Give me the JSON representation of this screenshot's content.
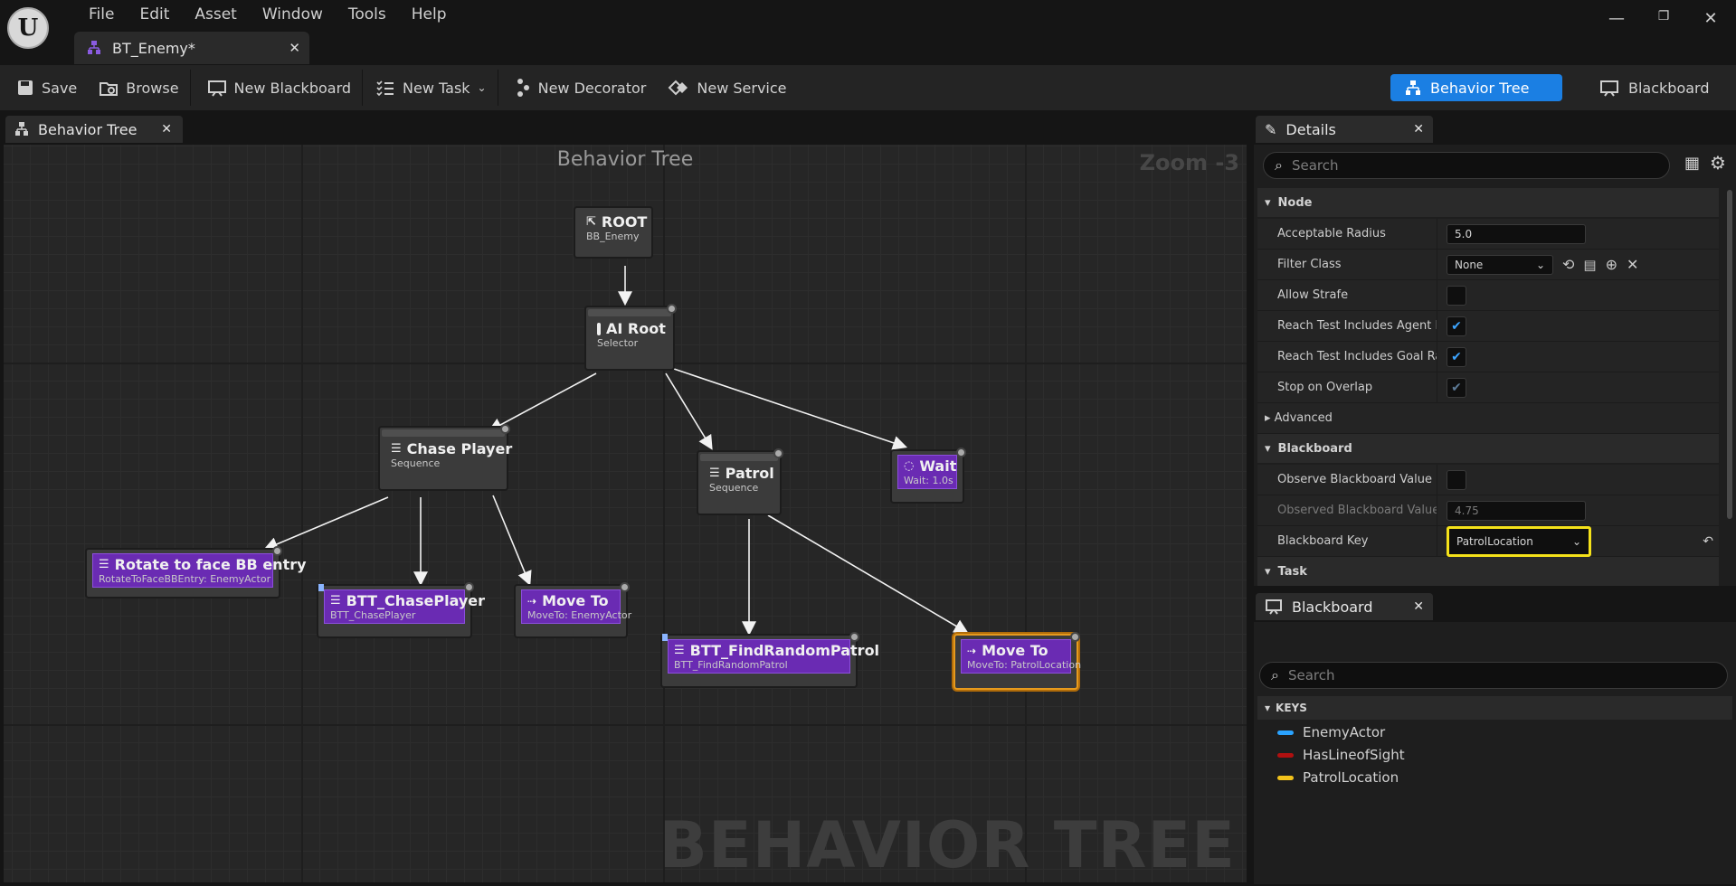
{
  "app": {
    "logo": "U",
    "menu": [
      "File",
      "Edit",
      "Asset",
      "Window",
      "Tools",
      "Help"
    ],
    "document_tab": "BT_Enemy*"
  },
  "toolbar": {
    "save": "Save",
    "browse": "Browse",
    "new_blackboard": "New Blackboard",
    "new_task": "New Task",
    "new_decorator": "New Decorator",
    "new_service": "New Service",
    "mode_behavior_tree": "Behavior Tree",
    "mode_blackboard": "Blackboard"
  },
  "graph": {
    "tab": "Behavior Tree",
    "title": "Behavior Tree",
    "zoom": "Zoom -3",
    "watermark": "BEHAVIOR TREE",
    "nodes": {
      "root": {
        "title": "ROOT",
        "sub": "BB_Enemy"
      },
      "ai_root": {
        "title": "AI Root",
        "sub": "Selector"
      },
      "chase": {
        "title": "Chase Player",
        "sub": "Sequence"
      },
      "patrol": {
        "title": "Patrol",
        "sub": "Sequence"
      },
      "wait": {
        "title": "Wait",
        "sub": "Wait: 1.0s"
      },
      "rotate": {
        "title": "Rotate to face BB entry",
        "sub": "RotateToFaceBBEntry: EnemyActor"
      },
      "btt_chase": {
        "title": "BTT_ChasePlayer",
        "sub": "BTT_ChasePlayer"
      },
      "moveto_enemy": {
        "title": "Move To",
        "sub": "MoveTo: EnemyActor"
      },
      "btt_find": {
        "title": "BTT_FindRandomPatrol",
        "sub": "BTT_FindRandomPatrol"
      },
      "moveto_patrol": {
        "title": "Move To",
        "sub": "MoveTo: PatrolLocation"
      }
    }
  },
  "details": {
    "tab": "Details",
    "search_placeholder": "Search",
    "node_section": "Node",
    "acceptable_radius_label": "Acceptable Radius",
    "acceptable_radius_value": "5.0",
    "filter_class_label": "Filter Class",
    "filter_class_value": "None",
    "allow_strafe_label": "Allow Strafe",
    "allow_strafe_checked": false,
    "reach_agent_label": "Reach Test Includes Agent R...",
    "reach_agent_checked": true,
    "reach_goal_label": "Reach Test Includes Goal Ra...",
    "reach_goal_checked": true,
    "stop_overlap_label": "Stop on Overlap",
    "stop_overlap_checked": true,
    "advanced_section": "Advanced",
    "blackboard_section": "Blackboard",
    "observe_label": "Observe Blackboard Value",
    "observe_checked": false,
    "observed_label": "Observed Blackboard Value...",
    "observed_value": "4.75",
    "bb_key_label": "Blackboard Key",
    "bb_key_value": "PatrolLocation",
    "task_section": "Task"
  },
  "blackboard": {
    "tab": "Blackboard",
    "search_placeholder": "Search",
    "keys_header": "KEYS",
    "keys": [
      {
        "name": "EnemyActor",
        "color": "#2aa3ff"
      },
      {
        "name": "HasLineofSight",
        "color": "#b01010"
      },
      {
        "name": "PatrolLocation",
        "color": "#f2c21b"
      }
    ]
  },
  "colors": {
    "accent": "#1b7fe3",
    "task": "#6a2bb3",
    "selected": "#e69a1d",
    "highlight": "#f5e21a"
  }
}
